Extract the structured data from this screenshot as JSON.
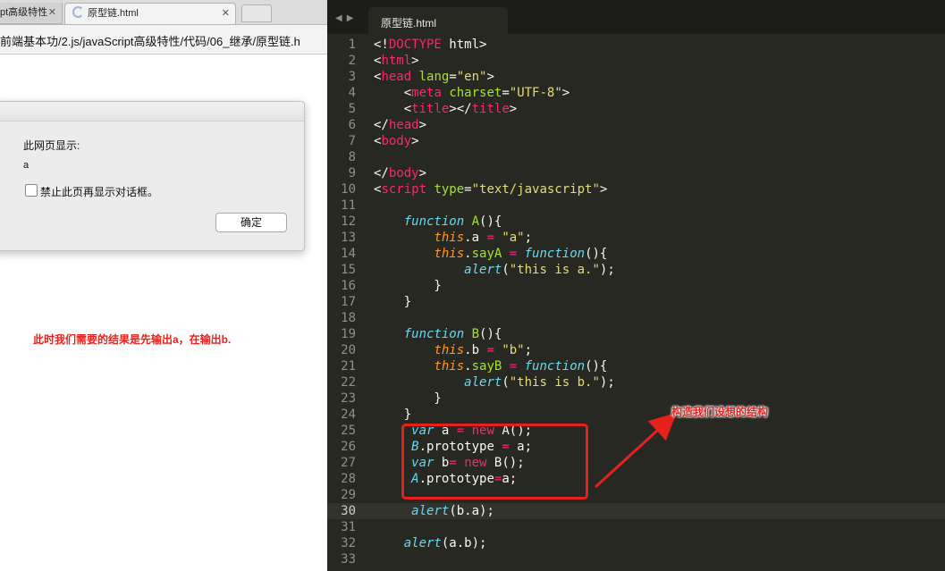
{
  "browser": {
    "tabs": [
      {
        "label": "pt高级特性"
      },
      {
        "label": "原型链.html"
      }
    ],
    "url": "前端基本功/2.js/javaScript高级特性/代码/06_继承/原型链.h",
    "dialog": {
      "title": "此网页显示:",
      "message": "a",
      "checkbox_label": "禁止此页再显示对话框。",
      "ok_label": "确定"
    }
  },
  "annotations": {
    "left": "此时我们需要的结果是先输出a，在输出b.",
    "right": "构造我们设想的结构"
  },
  "editor": {
    "tab_label": "原型链.html",
    "highlighted_line": 30,
    "lines": [
      {
        "n": "1"
      },
      {
        "n": "2"
      },
      {
        "n": "3"
      },
      {
        "n": "4"
      },
      {
        "n": "5"
      },
      {
        "n": "6"
      },
      {
        "n": "7"
      },
      {
        "n": "8"
      },
      {
        "n": "9"
      },
      {
        "n": "10"
      },
      {
        "n": "11"
      },
      {
        "n": "12"
      },
      {
        "n": "13"
      },
      {
        "n": "14"
      },
      {
        "n": "15"
      },
      {
        "n": "16"
      },
      {
        "n": "17"
      },
      {
        "n": "18"
      },
      {
        "n": "19"
      },
      {
        "n": "20"
      },
      {
        "n": "21"
      },
      {
        "n": "22"
      },
      {
        "n": "23"
      },
      {
        "n": "24"
      },
      {
        "n": "25"
      },
      {
        "n": "26"
      },
      {
        "n": "27"
      },
      {
        "n": "28"
      },
      {
        "n": "29"
      },
      {
        "n": "30"
      },
      {
        "n": "31"
      },
      {
        "n": "32"
      },
      {
        "n": "33"
      }
    ],
    "code": [
      [
        [
          "t-plain",
          "<!"
        ],
        [
          "t-tag",
          "DOCTYPE"
        ],
        [
          "t-plain",
          " html>"
        ]
      ],
      [
        [
          "t-plain",
          "<"
        ],
        [
          "t-tag",
          "html"
        ],
        [
          "t-plain",
          ">"
        ]
      ],
      [
        [
          "t-plain",
          "<"
        ],
        [
          "t-tag",
          "head"
        ],
        [
          "t-plain",
          " "
        ],
        [
          "t-attr",
          "lang"
        ],
        [
          "t-plain",
          "="
        ],
        [
          "t-str",
          "\"en\""
        ],
        [
          "t-plain",
          ">"
        ]
      ],
      [
        [
          "t-plain",
          "    <"
        ],
        [
          "t-tag",
          "meta"
        ],
        [
          "t-plain",
          " "
        ],
        [
          "t-attr",
          "charset"
        ],
        [
          "t-plain",
          "="
        ],
        [
          "t-str",
          "\"UTF-8\""
        ],
        [
          "t-plain",
          ">"
        ]
      ],
      [
        [
          "t-plain",
          "    <"
        ],
        [
          "t-tag",
          "title"
        ],
        [
          "t-plain",
          "></"
        ],
        [
          "t-tag",
          "title"
        ],
        [
          "t-plain",
          ">"
        ]
      ],
      [
        [
          "t-plain",
          "</"
        ],
        [
          "t-tag",
          "head"
        ],
        [
          "t-plain",
          ">"
        ]
      ],
      [
        [
          "t-plain",
          "<"
        ],
        [
          "t-tag",
          "body"
        ],
        [
          "t-plain",
          ">"
        ]
      ],
      [],
      [
        [
          "t-plain",
          "</"
        ],
        [
          "t-tag",
          "body"
        ],
        [
          "t-plain",
          ">"
        ]
      ],
      [
        [
          "t-plain",
          "<"
        ],
        [
          "t-tag",
          "script"
        ],
        [
          "t-plain",
          " "
        ],
        [
          "t-attr",
          "type"
        ],
        [
          "t-plain",
          "="
        ],
        [
          "t-str",
          "\"text/javascript\""
        ],
        [
          "t-plain",
          ">"
        ]
      ],
      [],
      [
        [
          "t-plain",
          "    "
        ],
        [
          "t-kw",
          "function"
        ],
        [
          "t-plain",
          " "
        ],
        [
          "t-fn",
          "A"
        ],
        [
          "t-plain",
          "(){"
        ]
      ],
      [
        [
          "t-plain",
          "        "
        ],
        [
          "t-this",
          "this"
        ],
        [
          "t-plain",
          ".a "
        ],
        [
          "t-op",
          "="
        ],
        [
          "t-plain",
          " "
        ],
        [
          "t-str",
          "\"a\""
        ],
        [
          "t-plain",
          ";"
        ]
      ],
      [
        [
          "t-plain",
          "        "
        ],
        [
          "t-this",
          "this"
        ],
        [
          "t-plain",
          "."
        ],
        [
          "t-fn",
          "sayA"
        ],
        [
          "t-plain",
          " "
        ],
        [
          "t-op",
          "="
        ],
        [
          "t-plain",
          " "
        ],
        [
          "t-kw",
          "function"
        ],
        [
          "t-plain",
          "(){"
        ]
      ],
      [
        [
          "t-plain",
          "            "
        ],
        [
          "t-cls",
          "alert"
        ],
        [
          "t-plain",
          "("
        ],
        [
          "t-str",
          "\"this is a.\""
        ],
        [
          "t-plain",
          ");"
        ]
      ],
      [
        [
          "t-plain",
          "        }"
        ]
      ],
      [
        [
          "t-plain",
          "    }"
        ]
      ],
      [],
      [
        [
          "t-plain",
          "    "
        ],
        [
          "t-kw",
          "function"
        ],
        [
          "t-plain",
          " "
        ],
        [
          "t-fn",
          "B"
        ],
        [
          "t-plain",
          "(){"
        ]
      ],
      [
        [
          "t-plain",
          "        "
        ],
        [
          "t-this",
          "this"
        ],
        [
          "t-plain",
          ".b "
        ],
        [
          "t-op",
          "="
        ],
        [
          "t-plain",
          " "
        ],
        [
          "t-str",
          "\"b\""
        ],
        [
          "t-plain",
          ";"
        ]
      ],
      [
        [
          "t-plain",
          "        "
        ],
        [
          "t-this",
          "this"
        ],
        [
          "t-plain",
          "."
        ],
        [
          "t-fn",
          "sayB"
        ],
        [
          "t-plain",
          " "
        ],
        [
          "t-op",
          "="
        ],
        [
          "t-plain",
          " "
        ],
        [
          "t-kw",
          "function"
        ],
        [
          "t-plain",
          "(){"
        ]
      ],
      [
        [
          "t-plain",
          "            "
        ],
        [
          "t-cls",
          "alert"
        ],
        [
          "t-plain",
          "("
        ],
        [
          "t-str",
          "\"this is b.\""
        ],
        [
          "t-plain",
          ");"
        ]
      ],
      [
        [
          "t-plain",
          "        }"
        ]
      ],
      [
        [
          "t-plain",
          "    }"
        ]
      ],
      [
        [
          "t-plain",
          "     "
        ],
        [
          "t-kw",
          "var"
        ],
        [
          "t-plain",
          " a "
        ],
        [
          "t-op",
          "="
        ],
        [
          "t-plain",
          " "
        ],
        [
          "t-op",
          "new"
        ],
        [
          "t-plain",
          " A();"
        ]
      ],
      [
        [
          "t-plain",
          "     "
        ],
        [
          "t-cls",
          "B"
        ],
        [
          "t-plain",
          ".prototype "
        ],
        [
          "t-op",
          "="
        ],
        [
          "t-plain",
          " a;"
        ]
      ],
      [
        [
          "t-plain",
          "     "
        ],
        [
          "t-kw",
          "var"
        ],
        [
          "t-plain",
          " b"
        ],
        [
          "t-op",
          "="
        ],
        [
          "t-plain",
          " "
        ],
        [
          "t-op",
          "new"
        ],
        [
          "t-plain",
          " B();"
        ]
      ],
      [
        [
          "t-plain",
          "     "
        ],
        [
          "t-cls",
          "A"
        ],
        [
          "t-plain",
          ".prototype"
        ],
        [
          "t-op",
          "="
        ],
        [
          "t-plain",
          "a;"
        ]
      ],
      [],
      [
        [
          "t-plain",
          "     "
        ],
        [
          "t-cls",
          "alert"
        ],
        [
          "t-plain",
          "(b.a);"
        ]
      ],
      [],
      [
        [
          "t-plain",
          "    "
        ],
        [
          "t-cls",
          "alert"
        ],
        [
          "t-plain",
          "(a.b);"
        ]
      ],
      []
    ]
  }
}
